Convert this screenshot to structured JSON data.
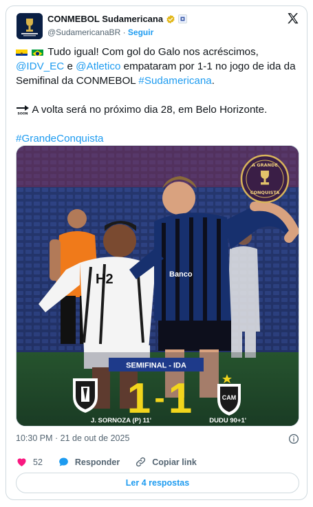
{
  "account": {
    "name": "CONMEBOL Sudamericana",
    "handle": "@SudamericanaBR",
    "separator": "·",
    "follow_label": "Seguir",
    "avatar_icon": "conmebol-sudamericana-logo"
  },
  "tweet": {
    "line1": "Tudo igual! Com gol do Galo nos acréscimos,",
    "mention1": "@IDV_EC",
    "connector": " e ",
    "mention2": "@Atletico",
    "line2_rest": " empataram por 1-1 no jogo de ida da Semifinal da CONMEBOL ",
    "hashtag1": "#Sudamericana",
    "line2_end": ".",
    "line3": " A volta será no próximo dia 28, em Belo Horizonte.",
    "hashtag2": "#GrandeConquista"
  },
  "media": {
    "badge_line1": "A GRANDE",
    "badge_line2": "CONQUISTA",
    "stage": "SEMIFINAL - IDA",
    "score_home": "1",
    "score_sep": "-",
    "score_away": "1",
    "scorer_home": "J. SORNOZA (P) 11'",
    "scorer_away": "DUDU 90+1'",
    "away_crest_text": "CAM"
  },
  "meta": {
    "timestamp": "10:30 PM · 21 de out de 2025"
  },
  "actions": {
    "likes": "52",
    "reply_label": "Responder",
    "copy_label": "Copiar link",
    "read_replies": "Ler 4 respostas"
  },
  "colors": {
    "link": "#1d9bf0",
    "like": "#f91880",
    "verified": "#e2b719",
    "banner": "#f2d51c"
  }
}
